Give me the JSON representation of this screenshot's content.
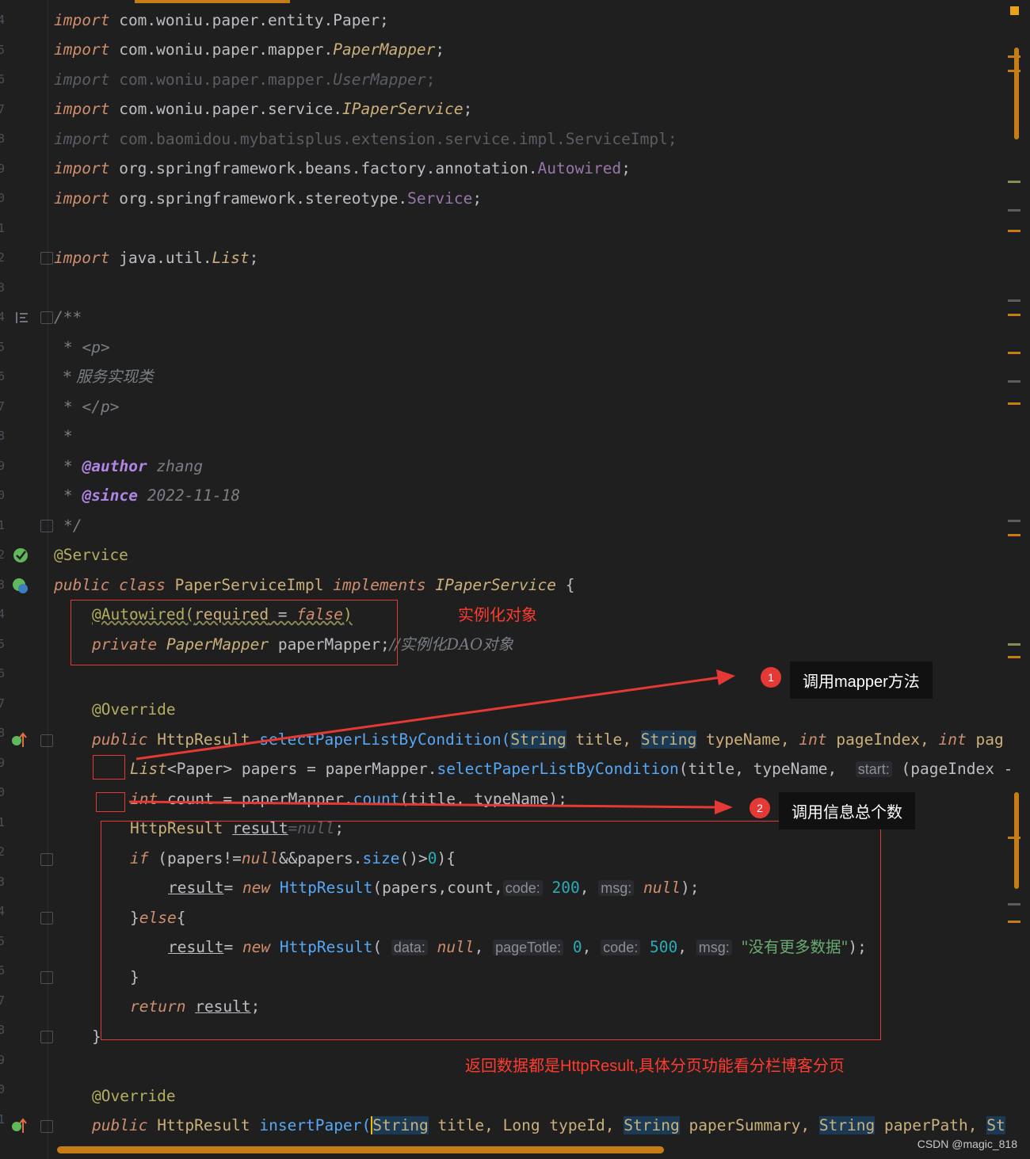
{
  "code": {
    "l1": [
      "import",
      "com.woniu.paper.entity.",
      "Paper",
      ";"
    ],
    "l2": [
      "import",
      "com.woniu.paper.mapper.",
      "PaperMapper",
      ";"
    ],
    "l3": [
      "import",
      "com.woniu.paper.mapper.",
      "UserMapper",
      ";"
    ],
    "l4": [
      "import",
      "com.woniu.paper.service.",
      "IPaperService",
      ";"
    ],
    "l5": [
      "import",
      "com.baomidou.mybatisplus.extension.service.impl.ServiceImpl;"
    ],
    "l6": [
      "import",
      "org.springframework.beans.factory.annotation.",
      "Autowired",
      ";"
    ],
    "l7": [
      "import",
      "org.springframework.stereotype.",
      "Service",
      ";"
    ],
    "l8": [
      "import",
      "java.util.",
      "List",
      ";"
    ],
    "l9": "/**",
    "l10": "* <p>",
    "l11": "* 服务实现类",
    "l12": "* </p>",
    "l13": "*",
    "l14": [
      "*",
      "@author",
      "zhang"
    ],
    "l15": [
      "*",
      "@since",
      "2022-11-18"
    ],
    "l16": "*/",
    "l17": "@Service",
    "l18": [
      "public class",
      "PaperServiceImpl",
      "implements",
      "IPaperService",
      "{"
    ],
    "l19": [
      "@Autowired(",
      "required",
      " = ",
      "false",
      ")"
    ],
    "l20": [
      "private",
      "PaperMapper",
      "paperMapper;",
      "//实例化DAO对象"
    ],
    "l21": "@Override",
    "l22": [
      "public",
      "HttpResult",
      "selectPaperListByCondition(",
      "String",
      "title,",
      "String",
      "typeName,",
      "int",
      "pageIndex,",
      "int",
      "pag"
    ],
    "l23": [
      "List",
      "<Paper>",
      "papers = paperMapper.",
      "selectPaperListByCondition",
      "(title, typeName,",
      "start:",
      "(pageIndex -"
    ],
    "l24": [
      "int",
      "count = paperMapper.",
      "count",
      "(title, typeName);"
    ],
    "l25": [
      "HttpResult",
      "result",
      "=",
      "null",
      ";"
    ],
    "l26": [
      "if",
      "(papers!=",
      "null",
      "&&papers.",
      "size",
      "()>",
      "0",
      "){"
    ],
    "l27": [
      "result",
      "= ",
      "new",
      "HttpResult",
      "(papers,count,",
      "code:",
      "200",
      ",",
      "msg:",
      "null",
      ");"
    ],
    "l28": [
      "}",
      "else",
      "{"
    ],
    "l29": [
      "result",
      "= ",
      "new",
      "HttpResult",
      "(",
      "data:",
      "null",
      ",",
      "pageTotle:",
      "0",
      ",",
      "code:",
      "500",
      ",",
      "msg:",
      "\"没有更多数据\"",
      ");"
    ],
    "l30": "}",
    "l31": [
      "return",
      "result",
      ";"
    ],
    "l32": "}",
    "l33": "@Override",
    "l34": [
      "public",
      "HttpResult",
      "insertPaper(",
      "String",
      "title, Long typeId,",
      "String",
      "paperSummary,",
      "String",
      "paperPath,",
      "St"
    ]
  },
  "line_numbers": [
    "4",
    "5",
    "6",
    "7",
    "8",
    "9",
    "0",
    "1",
    "2",
    "3",
    "4",
    "5",
    "6",
    "7",
    "8",
    "9",
    "0",
    "1",
    "2",
    "3",
    "4",
    "5",
    "6",
    "7",
    "8",
    "9",
    "0",
    "1",
    "2",
    "3",
    "4",
    "5",
    "6",
    "7",
    "8",
    "9",
    "0",
    "1"
  ],
  "annotations": {
    "instantiate_object": "实例化对象",
    "call_mapper_method": "调用mapper方法",
    "call_total_count": "调用信息总个数",
    "return_note": "返回数据都是HttpResult,具体分页功能看分栏博客分页",
    "badge1": "1",
    "badge2": "2"
  },
  "watermark": "CSDN @magic_818",
  "colors": {
    "keyword": "#cf8e6d",
    "annotation_red": "#e53935",
    "scrollbar": "#c77d15"
  }
}
